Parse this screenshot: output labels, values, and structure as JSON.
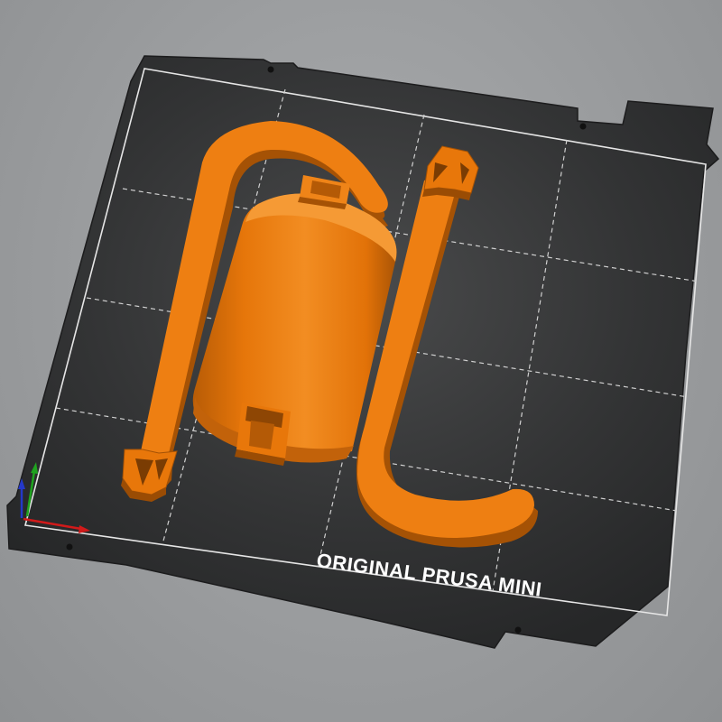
{
  "bed": {
    "label": "ORIGINAL PRUSA MINI"
  },
  "colors": {
    "background": "#9c9e a0",
    "bed_plate": "#2f3031",
    "grid_line": "#d8d8d8",
    "part_face": "#e8770a",
    "part_top": "#f08a1e",
    "part_side": "#b45a06",
    "part_shadow": "#8e4604",
    "axis_x": "#d11a1a",
    "axis_y": "#1fa31f",
    "axis_z": "#2438c9"
  },
  "icons": {
    "axes_gizmo": "xyz-axes-icon"
  }
}
